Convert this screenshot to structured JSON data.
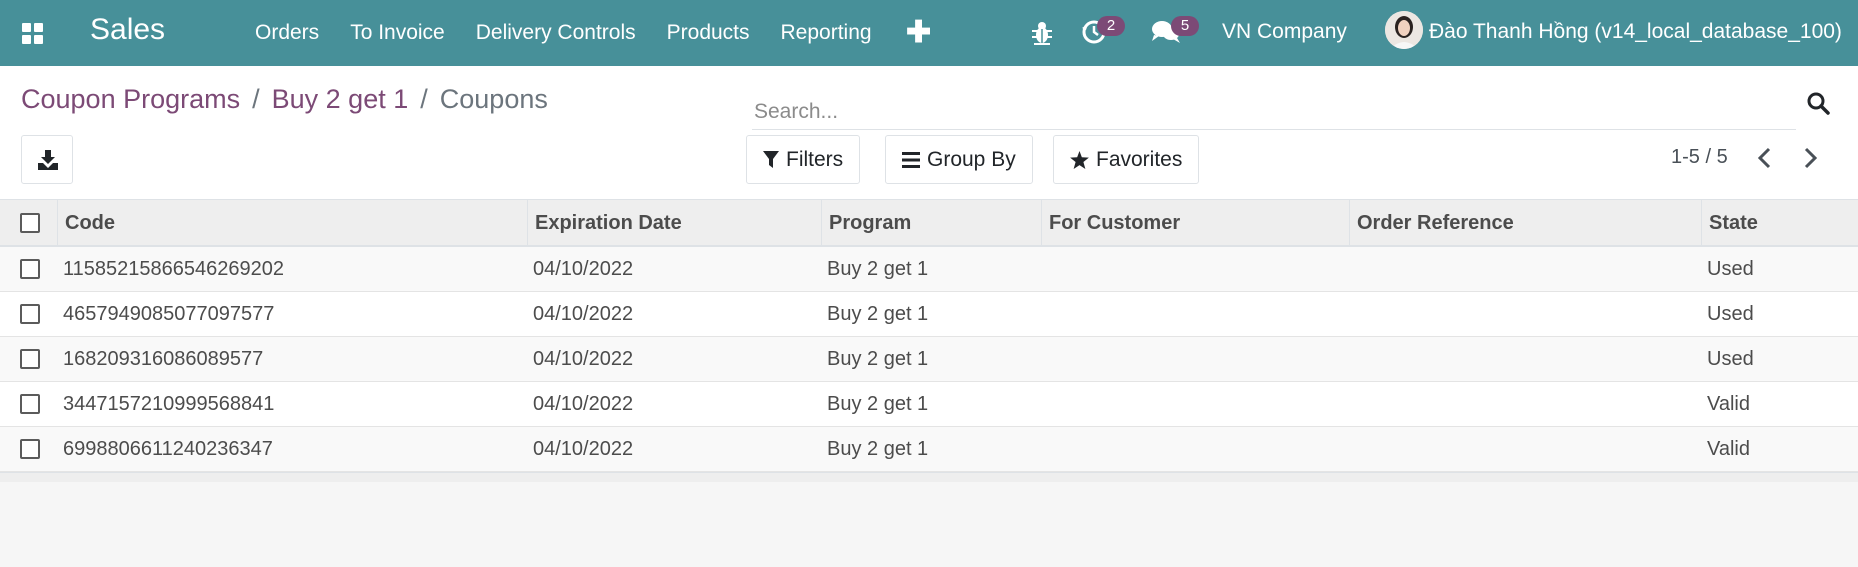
{
  "navbar": {
    "app_name": "Sales",
    "menu": [
      "Orders",
      "To Invoice",
      "Delivery Controls",
      "Products",
      "Reporting"
    ],
    "plus_label": "✚",
    "activity_count": "2",
    "message_count": "5",
    "company": "VN Company",
    "user_name": "Đào Thanh Hồng (v14_local_database_100)",
    "icons": [
      "apps-icon",
      "bug-icon",
      "activity-clock-icon",
      "chat-bubbles-icon"
    ],
    "accent_color": "#479099",
    "badge_color": "#7c4a76"
  },
  "breadcrumb": {
    "items": [
      "Coupon Programs",
      "Buy 2 get 1"
    ],
    "separator": "/",
    "current": "Coupons"
  },
  "search": {
    "placeholder": "Search...",
    "value": ""
  },
  "controls": {
    "filters_label": "Filters",
    "group_by_label": "Group By",
    "favorites_label": "Favorites",
    "pager": "1-5 / 5"
  },
  "table": {
    "columns": [
      "Code",
      "Expiration Date",
      "Program",
      "For Customer",
      "Order Reference",
      "State"
    ],
    "rows": [
      {
        "code": "11585215866546269202",
        "expiration": "04/10/2022",
        "program": "Buy 2 get 1",
        "customer": "",
        "order_ref": "",
        "state": "Used"
      },
      {
        "code": "4657949085077097577",
        "expiration": "04/10/2022",
        "program": "Buy 2 get 1",
        "customer": "",
        "order_ref": "",
        "state": "Used"
      },
      {
        "code": "168209316086089577",
        "expiration": "04/10/2022",
        "program": "Buy 2 get 1",
        "customer": "",
        "order_ref": "",
        "state": "Used"
      },
      {
        "code": "3447157210999568841",
        "expiration": "04/10/2022",
        "program": "Buy 2 get 1",
        "customer": "",
        "order_ref": "",
        "state": "Valid"
      },
      {
        "code": "6998806611240236347",
        "expiration": "04/10/2022",
        "program": "Buy 2 get 1",
        "customer": "",
        "order_ref": "",
        "state": "Valid"
      }
    ]
  }
}
